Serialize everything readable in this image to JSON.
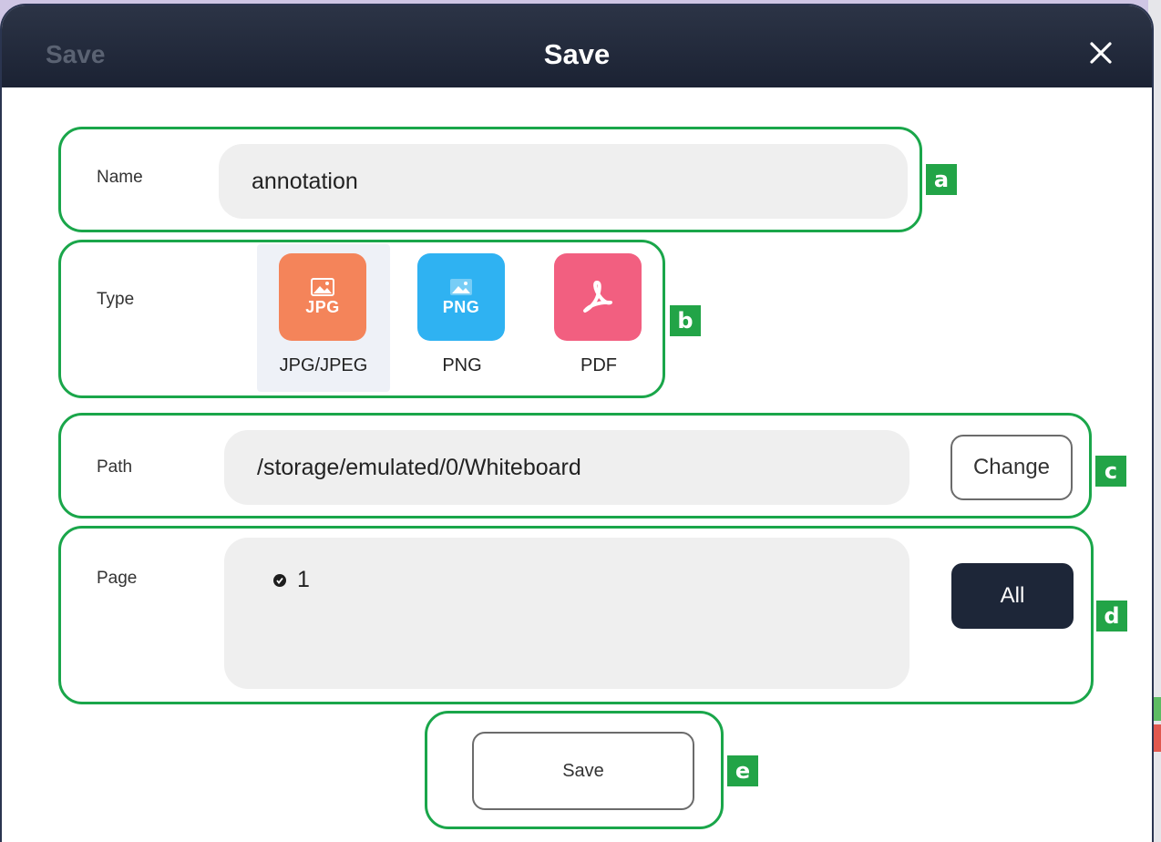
{
  "dialog": {
    "ghost_title": "Save",
    "title": "Save",
    "close_icon": "close-icon"
  },
  "name_row": {
    "label": "Name",
    "value": "annotation"
  },
  "type_row": {
    "label": "Type",
    "options": [
      {
        "caption": "JPG/JPEG",
        "icon_text": "JPG",
        "color": "#f4845a",
        "selected": true,
        "icon": "image-file-icon"
      },
      {
        "caption": "PNG",
        "icon_text": "PNG",
        "color": "#2fb2f2",
        "selected": false,
        "icon": "image-file-icon"
      },
      {
        "caption": "PDF",
        "icon_text": "",
        "color": "#f25f80",
        "selected": false,
        "icon": "pdf-icon"
      }
    ]
  },
  "path_row": {
    "label": "Path",
    "value": "/storage/emulated/0/Whiteboard",
    "change_label": "Change"
  },
  "page_row": {
    "label": "Page",
    "pages": [
      "1"
    ],
    "all_label": "All"
  },
  "save_button": {
    "label": "Save"
  },
  "callouts": {
    "a": "a",
    "b": "b",
    "c": "c",
    "d": "d",
    "e": "e"
  },
  "colors": {
    "titlebar": "#1b2233",
    "highlight": "#1aa64a",
    "tag": "#22a447",
    "all_button": "#1d2638",
    "field_bg": "#efefef"
  }
}
